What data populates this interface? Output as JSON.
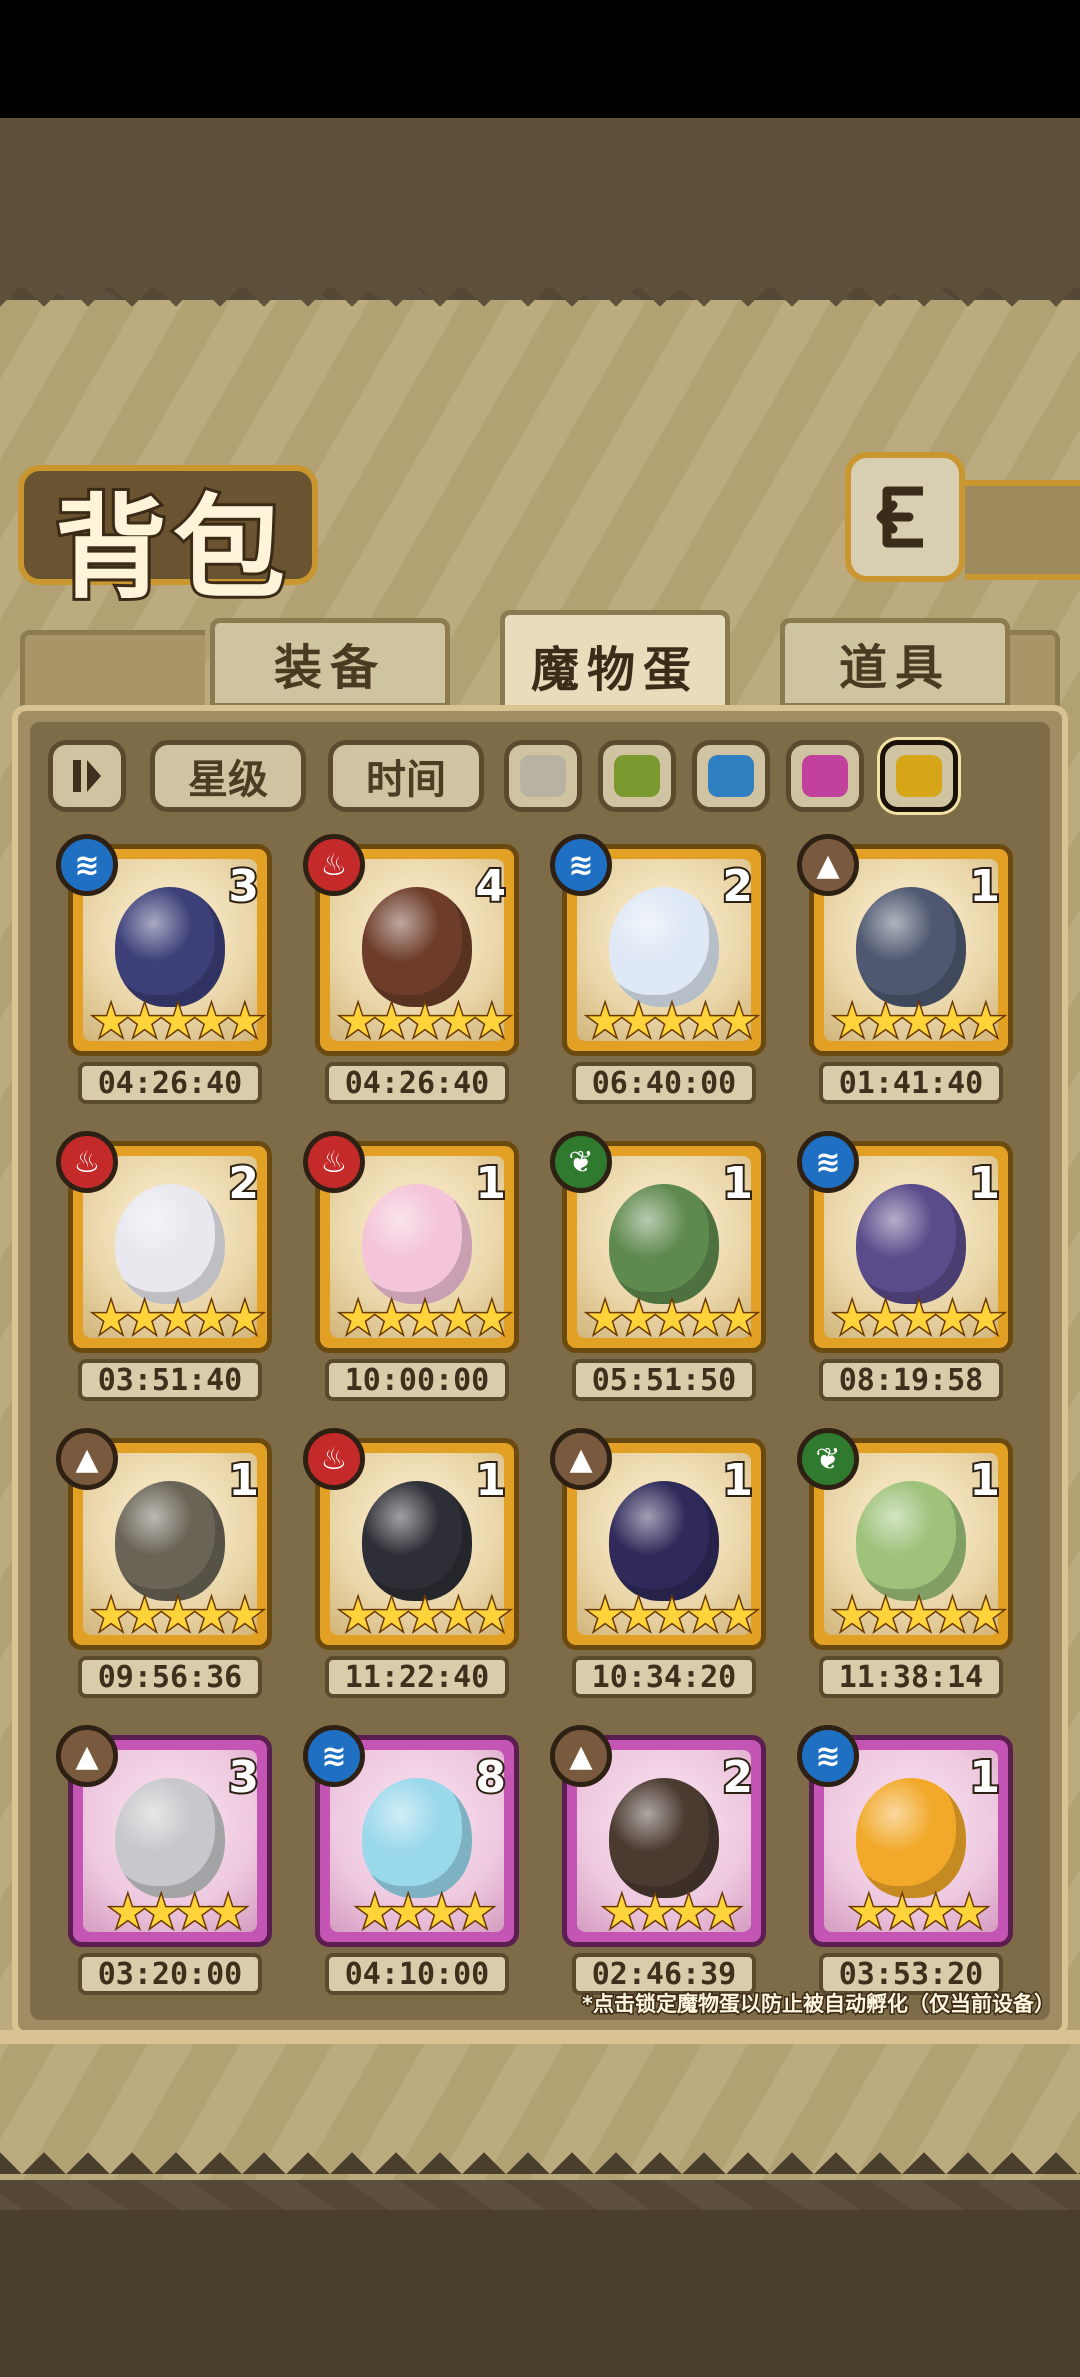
{
  "page": {
    "title": "背包"
  },
  "tabs": [
    {
      "label": "装备",
      "active": false
    },
    {
      "label": "魔物蛋",
      "active": true
    },
    {
      "label": "道具",
      "active": false
    }
  ],
  "filters": {
    "toggle_icon": "pause-sort-icon",
    "star_label": "星级",
    "time_label": "时间",
    "swatches": [
      {
        "color": "#b8b2a3",
        "name": "gray"
      },
      {
        "color": "#7a9a2f",
        "name": "green"
      },
      {
        "color": "#2f80c0",
        "name": "blue"
      },
      {
        "color": "#c2419c",
        "name": "pink"
      },
      {
        "color": "#d7a518",
        "name": "gold",
        "selected": true
      }
    ]
  },
  "element_colors": {
    "water": "#1f6fc2",
    "fire": "#c42a2a",
    "earth": "#7a5a3e",
    "nature": "#2f7a2f"
  },
  "element_icons": {
    "water": "≋",
    "fire": "♨",
    "earth": "▲",
    "nature": "❦"
  },
  "eggs": [
    {
      "element": "water",
      "count": "3",
      "stars": "★★★★★",
      "time": "04:26:40",
      "rarity": "gold",
      "egg_color": "#3c3f78"
    },
    {
      "element": "fire",
      "count": "4",
      "stars": "★★★★★",
      "time": "04:26:40",
      "rarity": "gold",
      "egg_color": "#6e3d2a"
    },
    {
      "element": "water",
      "count": "2",
      "stars": "★★★★★",
      "time": "06:40:00",
      "rarity": "gold",
      "egg_color": "#dfe8f5"
    },
    {
      "element": "earth",
      "count": "1",
      "stars": "★★★★★",
      "time": "01:41:40",
      "rarity": "gold",
      "egg_color": "#4f5870"
    },
    {
      "element": "fire",
      "count": "2",
      "stars": "★★★★★",
      "time": "03:51:40",
      "rarity": "gold",
      "egg_color": "#e8e8ee"
    },
    {
      "element": "fire",
      "count": "1",
      "stars": "★★★★★",
      "time": "10:00:00",
      "rarity": "gold",
      "egg_color": "#f4c4d8"
    },
    {
      "element": "nature",
      "count": "1",
      "stars": "★★★★★",
      "time": "05:51:50",
      "rarity": "gold",
      "egg_color": "#5f8a4e"
    },
    {
      "element": "water",
      "count": "1",
      "stars": "★★★★★",
      "time": "08:19:58",
      "rarity": "gold",
      "egg_color": "#5a4b8a"
    },
    {
      "element": "earth",
      "count": "1",
      "stars": "★★★★★",
      "time": "09:56:36",
      "rarity": "gold",
      "egg_color": "#6a6456"
    },
    {
      "element": "fire",
      "count": "1",
      "stars": "★★★★★",
      "time": "11:22:40",
      "rarity": "gold",
      "egg_color": "#2e2e36"
    },
    {
      "element": "earth",
      "count": "1",
      "stars": "★★★★★",
      "time": "10:34:20",
      "rarity": "gold",
      "egg_color": "#2f2a5a"
    },
    {
      "element": "nature",
      "count": "1",
      "stars": "★★★★★",
      "time": "11:38:14",
      "rarity": "gold",
      "egg_color": "#9ec27a"
    },
    {
      "element": "earth",
      "count": "3",
      "stars": "★★★★",
      "time": "03:20:00",
      "rarity": "pink",
      "egg_color": "#c8c8cc"
    },
    {
      "element": "water",
      "count": "8",
      "stars": "★★★★",
      "time": "04:10:00",
      "rarity": "pink",
      "egg_color": "#9ad8ec"
    },
    {
      "element": "earth",
      "count": "2",
      "stars": "★★★★",
      "time": "02:46:39",
      "rarity": "pink",
      "egg_color": "#4a3a30"
    },
    {
      "element": "water",
      "count": "1",
      "stars": "★★★★",
      "time": "03:53:20",
      "rarity": "pink",
      "egg_color": "#f2a92a"
    }
  ],
  "footer_note": "*点击锁定魔物蛋以防止被自动孵化（仅当前设备）"
}
